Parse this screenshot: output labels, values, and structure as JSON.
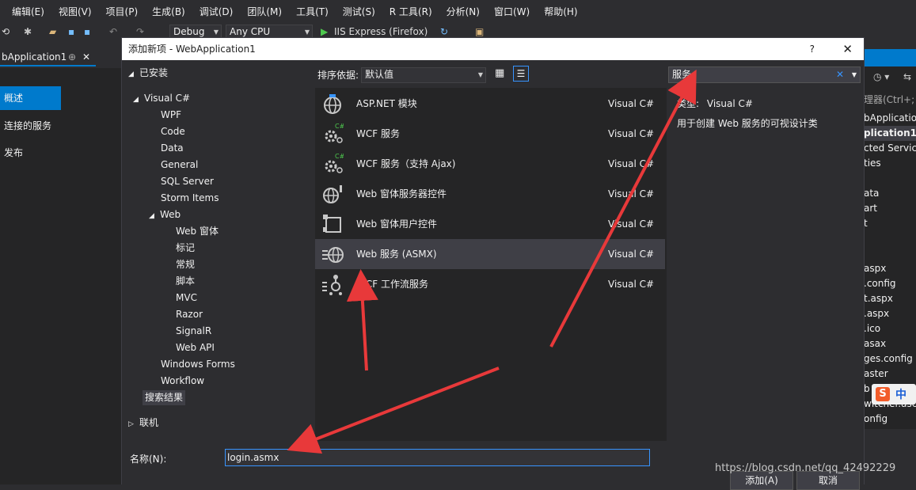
{
  "menu": [
    "编辑(E)",
    "视图(V)",
    "项目(P)",
    "生成(B)",
    "调试(D)",
    "团队(M)",
    "工具(T)",
    "测试(S)",
    "R 工具(R)",
    "分析(N)",
    "窗口(W)",
    "帮助(H)"
  ],
  "toolbar": {
    "config": "Debug",
    "platform": "Any CPU",
    "run_target": "IIS Express (Firefox)"
  },
  "doc_tab": "bApplication1",
  "left_pane": {
    "items": [
      "概述",
      "连接的服务",
      "发布"
    ],
    "selected": "概述"
  },
  "right_pane": {
    "items": [
      "理器(Ctrl+;",
      "bApplicatio",
      "plication1",
      "cted Service",
      "ties",
      "ata",
      "art",
      "t",
      "aspx",
      ".config",
      "t.aspx",
      ".aspx",
      ".ico",
      "asax",
      "ges.config",
      "aster",
      "b",
      "witcher.ascx",
      "onfig"
    ]
  },
  "dialog": {
    "title": "添加新项 - WebApplication1",
    "help_label": "?",
    "close_label": "✕",
    "tree": {
      "installed": "已安装",
      "visual_csharp": "Visual C#",
      "children": [
        "WPF",
        "Code",
        "Data",
        "General",
        "SQL Server",
        "Storm Items"
      ],
      "web": "Web",
      "web_children": [
        "Web 窗体",
        "标记",
        "常规",
        "脚本",
        "MVC",
        "Razor",
        "SignalR",
        "Web API"
      ],
      "after_web": [
        "Windows Forms",
        "Workflow"
      ],
      "search_results": "搜索结果",
      "online": "联机"
    },
    "sort_label": "排序依据:",
    "sort_value": "默认值",
    "templates": [
      {
        "name": "ASP.NET 模块",
        "lang": "Visual C#",
        "icon": "globe-icon"
      },
      {
        "name": "WCF 服务",
        "lang": "Visual C#",
        "icon": "wcf-gear-icon"
      },
      {
        "name": "WCF 服务（支持 Ajax)",
        "lang": "Visual C#",
        "icon": "wcf-gear-icon"
      },
      {
        "name": "Web 窗体服务器控件",
        "lang": "Visual C#",
        "icon": "globe-control-icon"
      },
      {
        "name": "Web 窗体用户控件",
        "lang": "Visual C#",
        "icon": "user-control-icon"
      },
      {
        "name": "Web 服务 (ASMX)",
        "lang": "Visual C#",
        "icon": "web-service-icon"
      },
      {
        "name": "WCF 工作流服务",
        "lang": "Visual C#",
        "icon": "workflow-icon"
      }
    ],
    "selected_index": 5,
    "search_value": "服务",
    "details": {
      "type_label": "类型:",
      "type_value": "Visual C#",
      "description": "用于创建 Web 服务的可视设计类"
    },
    "name_label": "名称(N):",
    "name_value": "login.asmx",
    "add_button": "添加(A)",
    "cancel_button": "取消"
  },
  "watermark": "https://blog.csdn.net/qq_42492229",
  "ime_label": "中",
  "colors": {
    "accent": "#007acc",
    "arrow": "#e8393a",
    "selected_row": "#3f3f46"
  }
}
